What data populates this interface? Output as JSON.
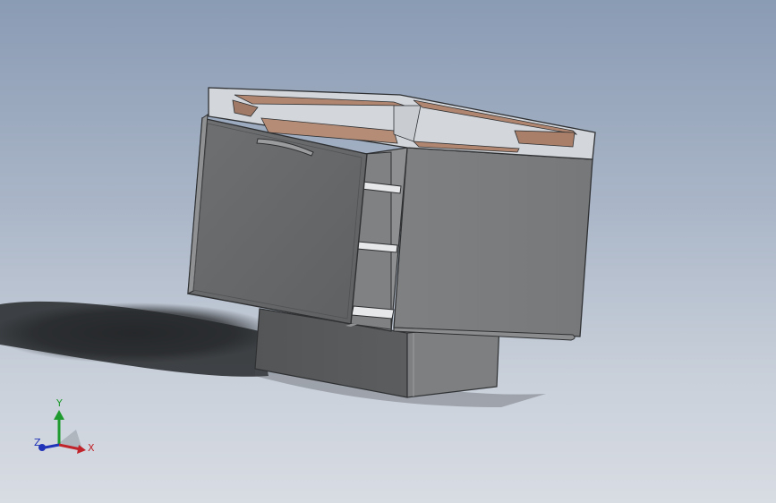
{
  "viewport": {
    "background_top": "#8a9bb4",
    "background_bottom": "#d8dce3"
  },
  "model": {
    "body_color": "#7a7c7e",
    "door_color": "#6a6c6e",
    "base_color": "#5c5e60",
    "top_panel_color": "#b08670",
    "frame_color": "#cfd3d8",
    "shadow_color": "#1e2022"
  },
  "triad": {
    "x_label": "X",
    "y_label": "Y",
    "z_label": "Z",
    "x_color": "#c0242a",
    "y_color": "#1e9a2e",
    "z_color": "#2033b8"
  }
}
